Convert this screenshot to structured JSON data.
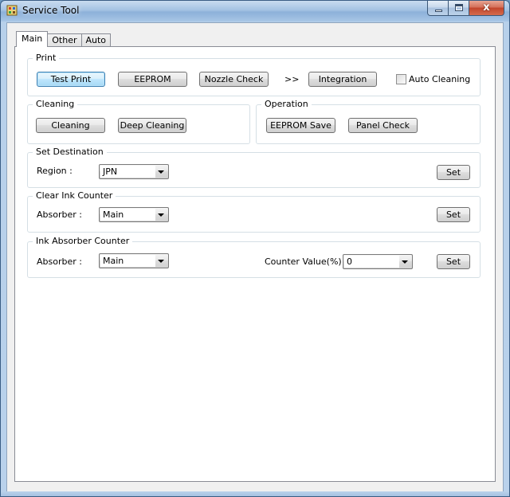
{
  "window": {
    "title": "Service Tool",
    "controls": {
      "minimize": "–",
      "maximize": "□",
      "close": "x"
    }
  },
  "tabs": [
    {
      "label": "Main",
      "active": true
    },
    {
      "label": "Other",
      "active": false
    },
    {
      "label": "Auto",
      "active": false
    }
  ],
  "print": {
    "title": "Print",
    "test_print": "Test Print",
    "eeprom": "EEPROM",
    "nozzle_check": "Nozzle Check",
    "arrows": ">>",
    "integration": "Integration",
    "auto_cleaning": "Auto Cleaning",
    "auto_cleaning_checked": false
  },
  "cleaning": {
    "title": "Cleaning",
    "cleaning": "Cleaning",
    "deep_cleaning": "Deep Cleaning"
  },
  "operation": {
    "title": "Operation",
    "eeprom_save": "EEPROM Save",
    "panel_check": "Panel Check"
  },
  "set_destination": {
    "title": "Set Destination",
    "region_label": "Region :",
    "region_value": "JPN",
    "set": "Set"
  },
  "clear_ink_counter": {
    "title": "Clear Ink Counter",
    "absorber_label": "Absorber :",
    "absorber_value": "Main",
    "set": "Set"
  },
  "ink_absorber_counter": {
    "title": "Ink Absorber Counter",
    "absorber_label": "Absorber :",
    "absorber_value": "Main",
    "counter_label": "Counter Value(%) :",
    "counter_value": "0",
    "set": "Set"
  },
  "colors": {
    "focus_border": "#3c7fb1",
    "close_button": "#c2452c",
    "group_border": "#d5dfe5"
  }
}
